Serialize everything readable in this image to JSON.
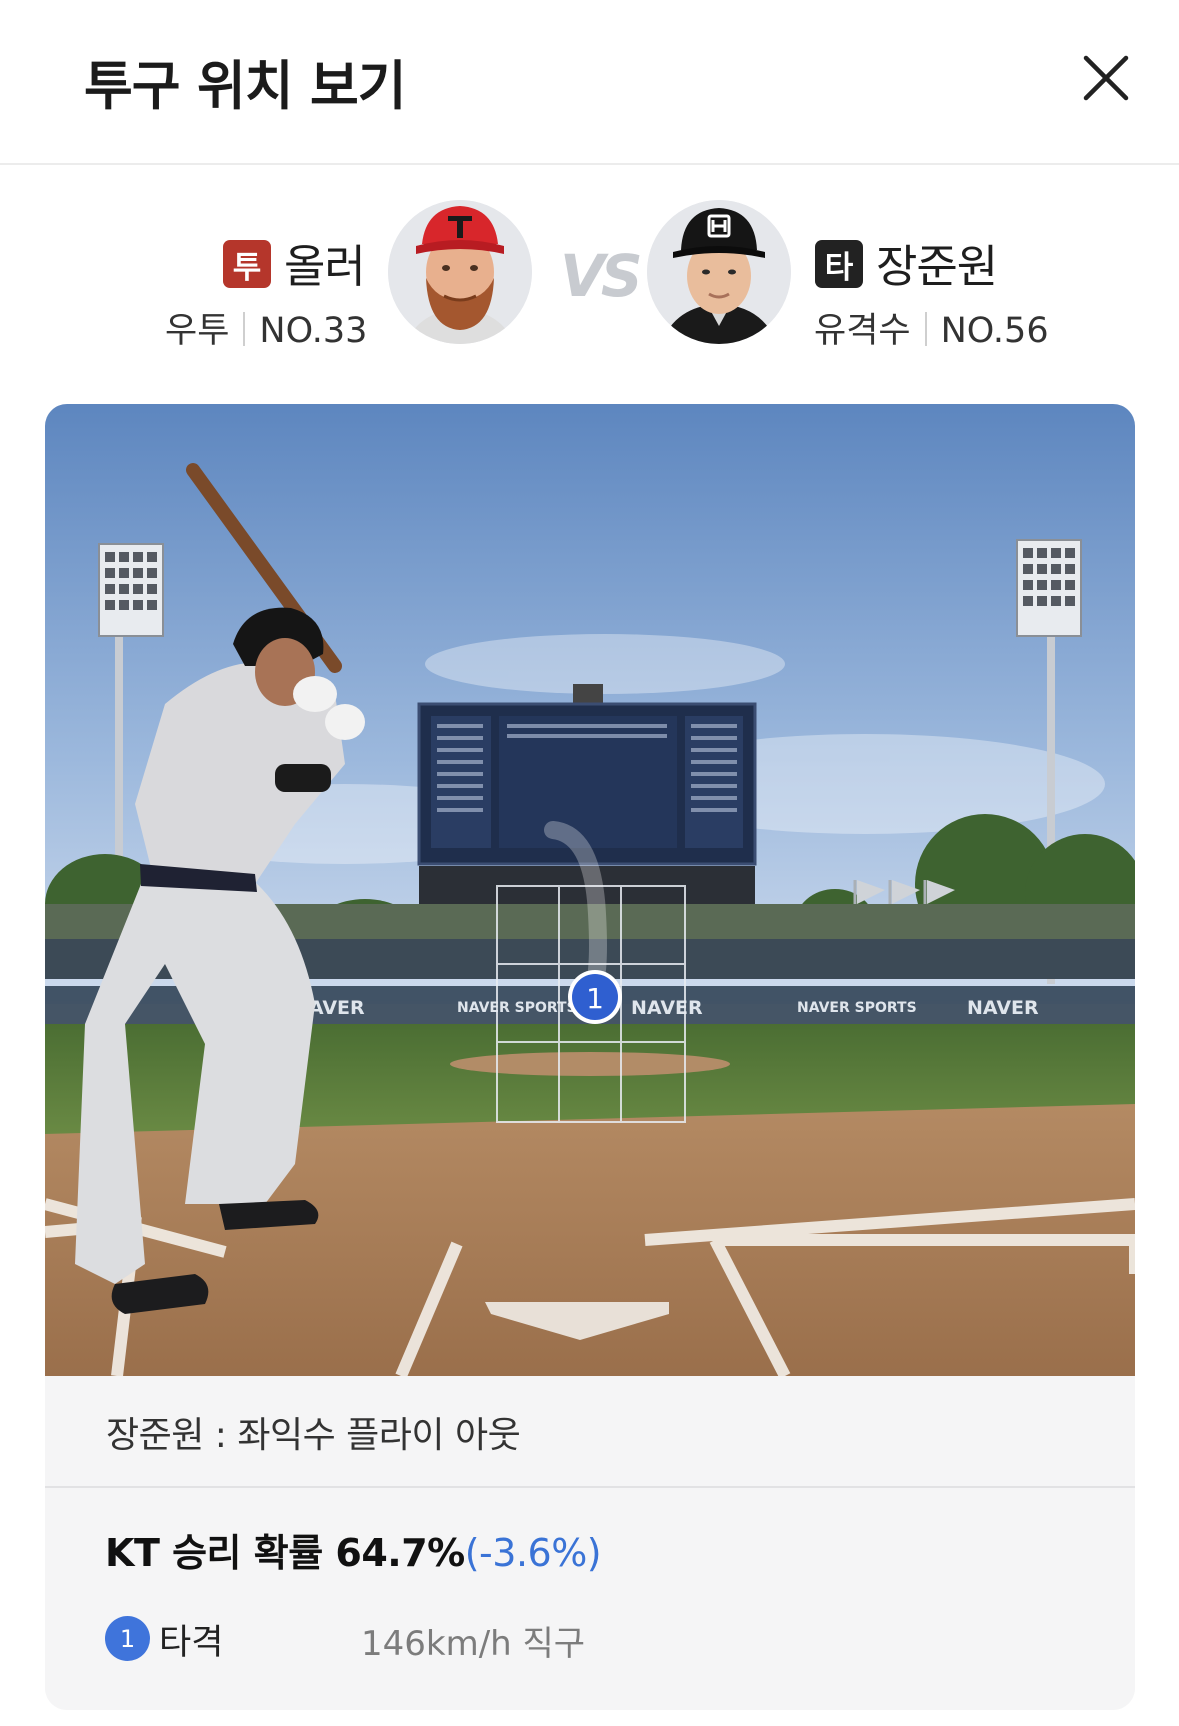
{
  "header": {
    "title": "투구 위치 보기",
    "close_icon": "close-icon"
  },
  "pitcher": {
    "badge": "투",
    "name": "올러",
    "hand": "우투",
    "number": "NO.33",
    "badge_color": "#b5362b"
  },
  "batter": {
    "badge": "타",
    "name": "장준원",
    "position": "유격수",
    "number": "NO.56",
    "badge_color": "#222222"
  },
  "vs_label": "VS",
  "field": {
    "board_brand": "NAVER",
    "ad_boards": [
      "NAVER",
      "NAVER SPORTS",
      "NAVER",
      "NAVER SPORTS",
      "NAVER"
    ],
    "pitch_marker": "1",
    "marker_color": "#2f5fd0"
  },
  "result": {
    "text": "장준원 : 좌익수 플라이 아웃"
  },
  "win_probability": {
    "label": "KT 승리 확률 64.7%",
    "delta": "(-3.6%)",
    "delta_color": "#3a73d6"
  },
  "pitches": [
    {
      "number": "1",
      "result": "타격",
      "speed": "146km/h",
      "type": "직구"
    }
  ]
}
